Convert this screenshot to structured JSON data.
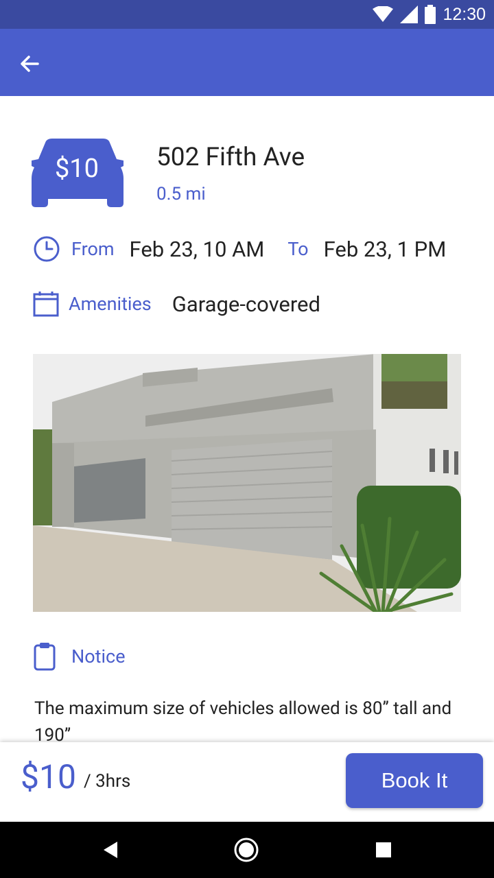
{
  "status_bar": {
    "time": "12:30"
  },
  "listing": {
    "price_badge": "$10",
    "address": "502 Fifth Ave",
    "distance": "0.5 mi",
    "from_label": "From",
    "from_value": "Feb 23, 10 AM",
    "to_label": "To",
    "to_value": "Feb 23, 1 PM",
    "amenities_label": "Amenities",
    "amenities_value": "Garage-covered",
    "notice_label": "Notice",
    "notice_text": "The maximum size of vehicles allowed is 80” tall and 190”"
  },
  "footer": {
    "total_price": "$10",
    "duration": "/ 3hrs",
    "book_label": "Book It"
  },
  "colors": {
    "primary": "#4a5ecc",
    "status_bar": "#3a4aa0"
  }
}
